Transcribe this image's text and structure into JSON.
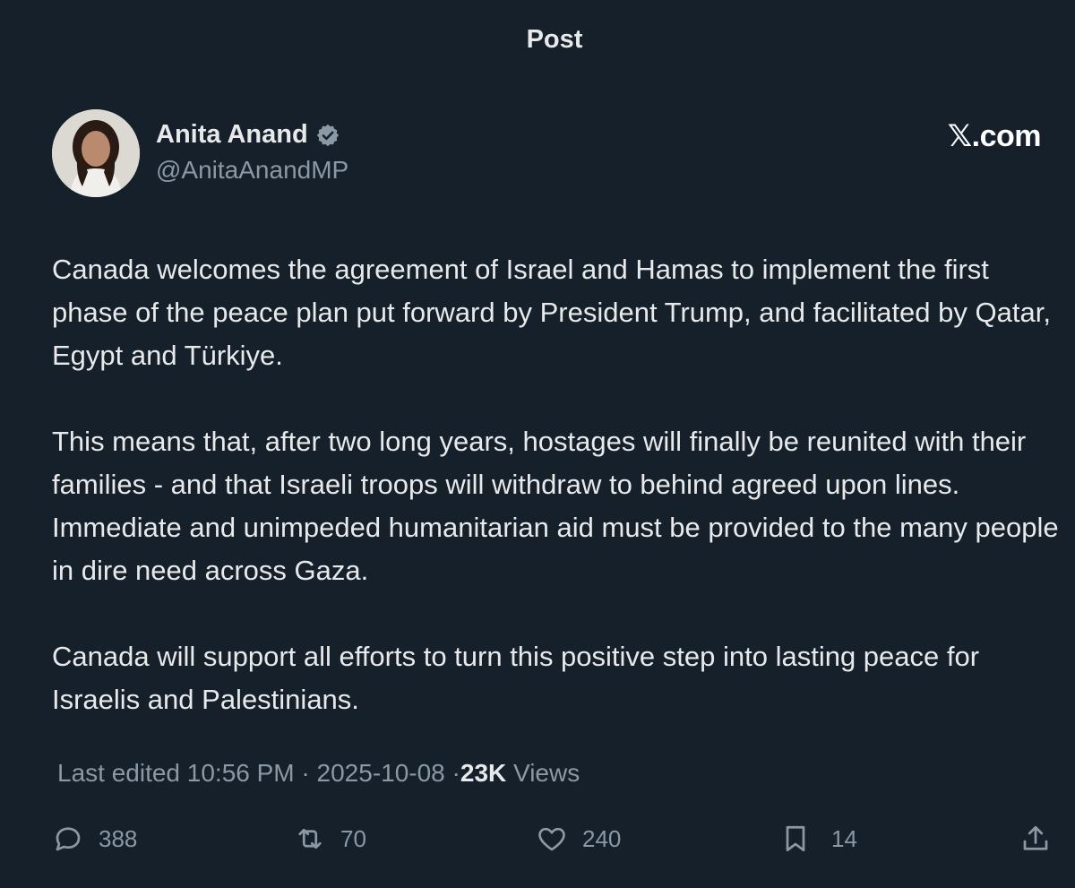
{
  "header": {
    "title": "Post"
  },
  "author": {
    "name": "Anita Anand",
    "handle": "@AnitaAnandMP",
    "verified": true
  },
  "brand": {
    "mark": "𝕏",
    "suffix": ".com"
  },
  "post": {
    "paragraphs": [
      "Canada welcomes the agreement of Israel and Hamas to implement the first phase of the peace plan put forward by President Trump, and facilitated by Qatar, Egypt and Türkiye.",
      "This means that, after two long years, hostages will finally be reunited with their families - and that Israeli troops will withdraw to behind agreed upon lines. Immediate and unimpeded humanitarian aid must be provided to the many people in dire need across Gaza.",
      "Canada will support all efforts to turn this positive step into lasting peace for Israelis and Palestinians."
    ]
  },
  "meta": {
    "edited_prefix": "Last edited",
    "time": "10:56 PM",
    "separator": "·",
    "date": "2025-10-08",
    "views_count": "23K",
    "views_label": "Views"
  },
  "actions": {
    "replies": "388",
    "reposts": "70",
    "likes": "240",
    "bookmarks": "14"
  },
  "colors": {
    "background": "#15202b",
    "text": "#e7e9ea",
    "muted": "#8b98a5",
    "verified": "#8b98a5"
  },
  "icons": {
    "reply": "speech-bubble-icon",
    "repost": "repost-arrows-icon",
    "like": "heart-icon",
    "bookmark": "bookmark-icon",
    "share": "share-upload-icon",
    "verified": "verified-badge-icon"
  }
}
